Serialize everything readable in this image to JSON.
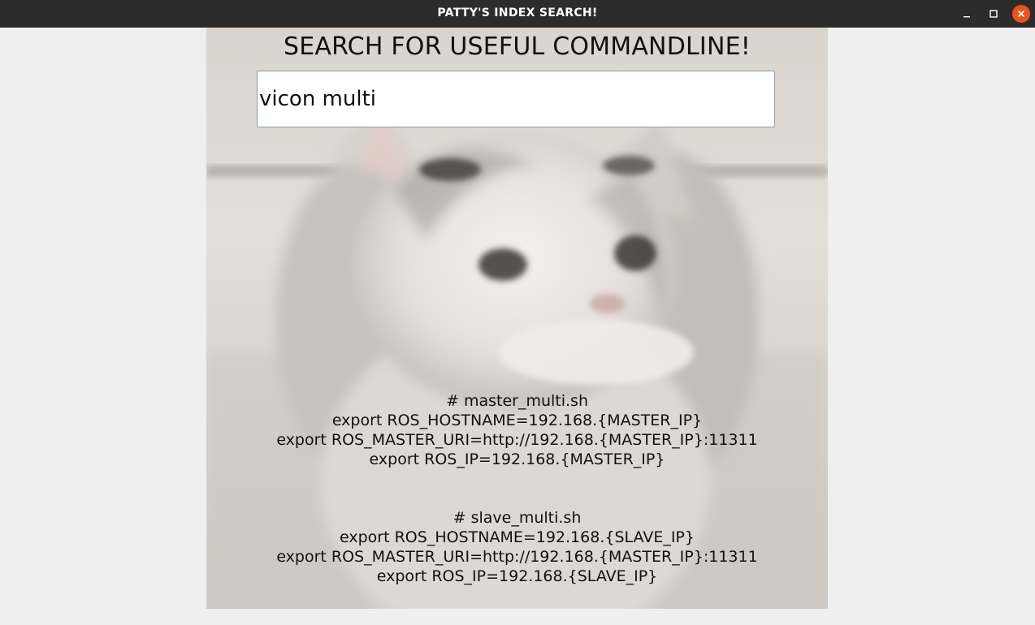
{
  "window": {
    "title": "PATTY'S INDEX SEARCH!",
    "close_color": "#e9541f",
    "titlebar_color": "#2c2c2c"
  },
  "main": {
    "heading": "SEARCH FOR USEFUL COMMANDLINE!",
    "search": {
      "value": "vicon multi",
      "placeholder": ""
    },
    "background_image": "cat-photo",
    "results": [
      {
        "lines": [
          "# master_multi.sh",
          "export ROS_HOSTNAME=192.168.{MASTER_IP}",
          "export ROS_MASTER_URI=http://192.168.{MASTER_IP}:11311",
          "export ROS_IP=192.168.{MASTER_IP}"
        ]
      },
      {
        "lines": [
          "# slave_multi.sh",
          "export ROS_HOSTNAME=192.168.{SLAVE_IP}",
          "export ROS_MASTER_URI=http://192.168.{MASTER_IP}:11311",
          "export ROS_IP=192.168.{SLAVE_IP}"
        ]
      }
    ]
  }
}
